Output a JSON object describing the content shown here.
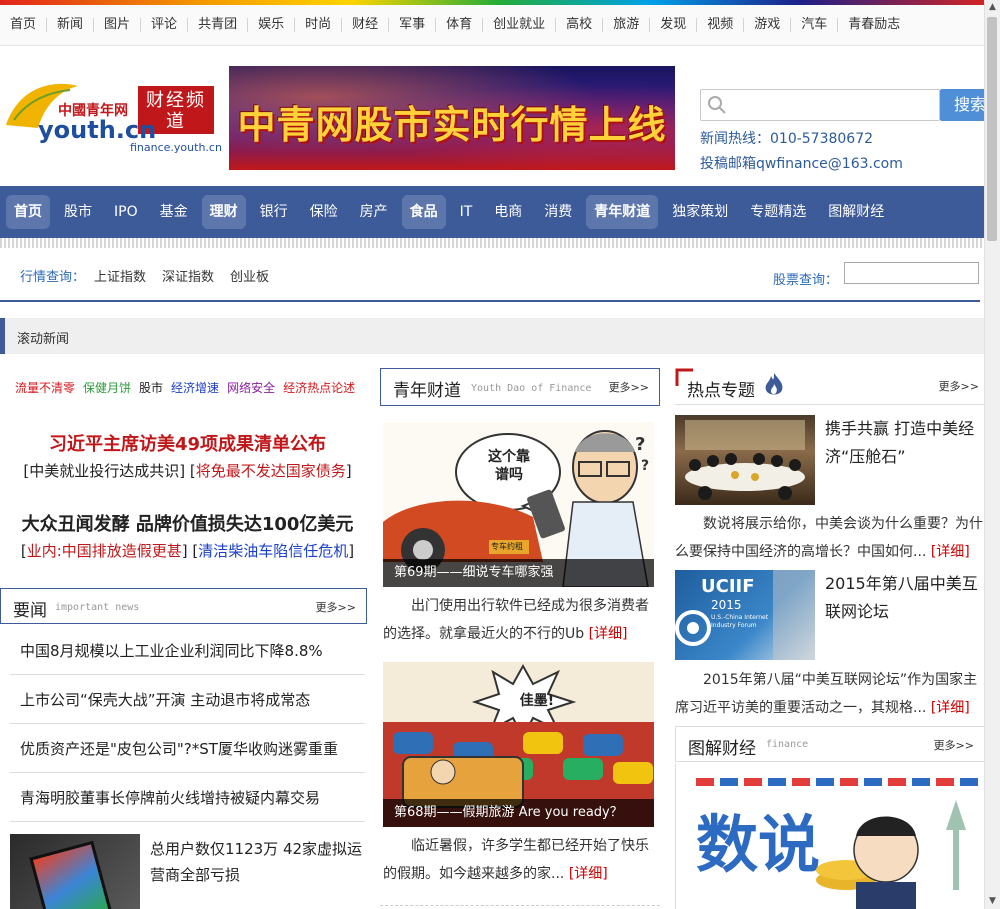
{
  "top_nav": [
    "首页",
    "新闻",
    "图片",
    "评论",
    "共青团",
    "娱乐",
    "时尚",
    "财经",
    "军事",
    "体育",
    "创业就业",
    "高校",
    "旅游",
    "发现",
    "视频",
    "游戏",
    "汽车",
    "青春励志"
  ],
  "logo": {
    "brand": "中國青年网",
    "domain_text": "youth.cn",
    "channel": "财经频道",
    "url_text": "finance.youth.cn"
  },
  "banner": {
    "text": "中青网股市实时行情上线"
  },
  "search": {
    "button": "搜索",
    "placeholder": ""
  },
  "contact": {
    "hotline": "新闻热线：010-57380672",
    "email": "投稿邮箱qwfinance@163.com"
  },
  "main_nav": [
    {
      "label": "首页",
      "hl": true
    },
    {
      "label": "股市",
      "hl": false
    },
    {
      "label": "IPO",
      "hl": false
    },
    {
      "label": "基金",
      "hl": false
    },
    {
      "label": "理财",
      "hl": true
    },
    {
      "label": "银行",
      "hl": false
    },
    {
      "label": "保险",
      "hl": false
    },
    {
      "label": "房产",
      "hl": false
    },
    {
      "label": "食品",
      "hl": true
    },
    {
      "label": "IT",
      "hl": false
    },
    {
      "label": "电商",
      "hl": false
    },
    {
      "label": "消费",
      "hl": false
    },
    {
      "label": "青年财道",
      "hl": true
    },
    {
      "label": "独家策划",
      "hl": false
    },
    {
      "label": "专题精选",
      "hl": false
    },
    {
      "label": "图解财经",
      "hl": false
    }
  ],
  "quote_bar": {
    "label": "行情查询：",
    "links": [
      "上证指数",
      "深证指数",
      "创业板"
    ],
    "stock_label": "股票查询："
  },
  "scroll_news": {
    "label": "滚动新闻"
  },
  "tags": [
    {
      "text": "流量不清零",
      "color": "#d7171c"
    },
    {
      "text": "保健月饼",
      "color": "#2f9c3c"
    },
    {
      "text": "股市",
      "color": "#222222"
    },
    {
      "text": "经济增速",
      "color": "#1a3fc9"
    },
    {
      "text": "网络安全",
      "color": "#8a1f9e"
    },
    {
      "text": "经济热点论述",
      "color": "#d7171c"
    }
  ],
  "headlines": [
    {
      "title": "习近平主席访美49项成果清单公布",
      "title_color": "#c0181a",
      "sub_a": "中美就业投行达成共识",
      "sub_b": "将免最不发达国家债务",
      "sub_b_color": "#c0181a"
    },
    {
      "title": "大众丑闻发酵 品牌价值损失达100亿美元",
      "title_color": "#222222",
      "sub_a": "业内:中国排放造假更甚",
      "sub_a_color": "#c0181a",
      "sub_b": "清洁柴油车陷信任危机",
      "sub_b_color": "#1a3fc9"
    }
  ],
  "yaowen": {
    "title": "要闻",
    "subtitle": "important news",
    "more": "更多>>",
    "items": [
      "中国8月规模以上工业企业利润同比下降8.8%",
      "上市公司“保壳大战”开演 主动退市将成常态",
      "优质资产还是\"皮包公司\"?*ST厦华收购迷雾重重",
      "青海明胶董事长停牌前火线增持被疑内幕交易"
    ],
    "image_item": "总用户数仅1123万 42家虚拟运营商全部亏损"
  },
  "qingnian": {
    "title": "青年财道",
    "subtitle": "Youth Dao of Finance",
    "more": "更多>>",
    "items": [
      {
        "caption": "第69期——细说专车哪家强",
        "bubble": "这个靠谱吗",
        "sign": "专车约租",
        "desc": "出门使用出行软件已经成为很多消费者的选择。就拿最近火的不行的Ub",
        "more": "[详细]"
      },
      {
        "caption": "第68期——假期旅游 Are you ready？",
        "bubble": "佳墨!",
        "desc": "临近暑假，许多学生都已经开始了快乐的假期。如今越来越多的家...",
        "more": "[详细]"
      }
    ]
  },
  "hot": {
    "title": "热点专题",
    "more": "更多>>",
    "items": [
      {
        "title": "携手共赢 打造中美经济“压舱石”",
        "desc": "数说将展示给你，中美会谈为什么重要？为什么要保持中国经济的高增长？中国如何...",
        "more": "[详细]"
      },
      {
        "title": "2015年第八届中美互联网论坛",
        "desc": "2015年第八届“中美互联网论坛”作为国家主席习近平访美的重要活动之一，其规格...",
        "more": "[详细]",
        "img_logo": "UCIIF",
        "img_year": "2015",
        "img_caption": "U.S.-China Internet Industry Forum"
      }
    ]
  },
  "tujie": {
    "title": "图解财经",
    "subtitle": "finance",
    "more": "更多>>",
    "cover_text": "数说"
  },
  "colors": {
    "nav_bg": "#3d5a99",
    "link_blue": "#2c6ab5",
    "red": "#c00000"
  }
}
